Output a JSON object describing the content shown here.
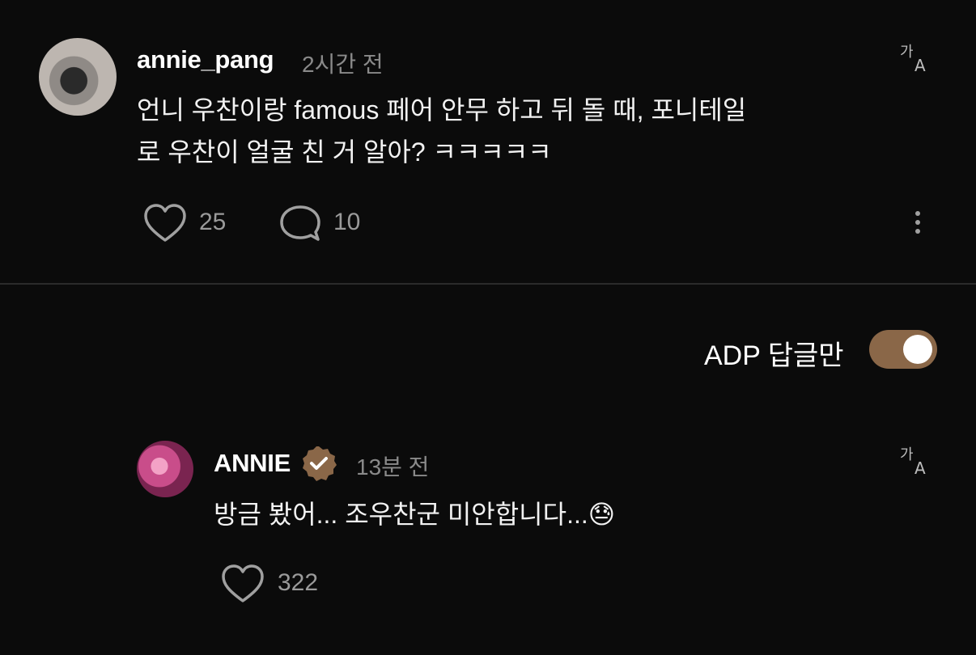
{
  "comment": {
    "username": "annie_pang",
    "time": "2시간 전",
    "text_line1": "언니 우찬이랑 famous 페어 안무 하고 뒤 돌 때, 포니테일",
    "text_line2": "로 우찬이 얼굴 친 거 알아? ㅋㅋㅋㅋㅋ",
    "likes": "25",
    "replies": "10"
  },
  "filter": {
    "label": "ADP 답글만",
    "enabled": true
  },
  "reply": {
    "username": "ANNIE",
    "time": "13분 전",
    "text": "방금 봤어... 조우찬군 미안합니다...😓",
    "likes": "322"
  },
  "icons": {
    "translate": "translate-icon",
    "heart": "heart-icon",
    "comment": "comment-bubble-icon",
    "more": "more-vertical-icon",
    "verified": "verified-badge-icon"
  },
  "colors": {
    "background": "#0b0b0b",
    "toggle_on": "#8a6748",
    "verified": "#8a6748"
  }
}
